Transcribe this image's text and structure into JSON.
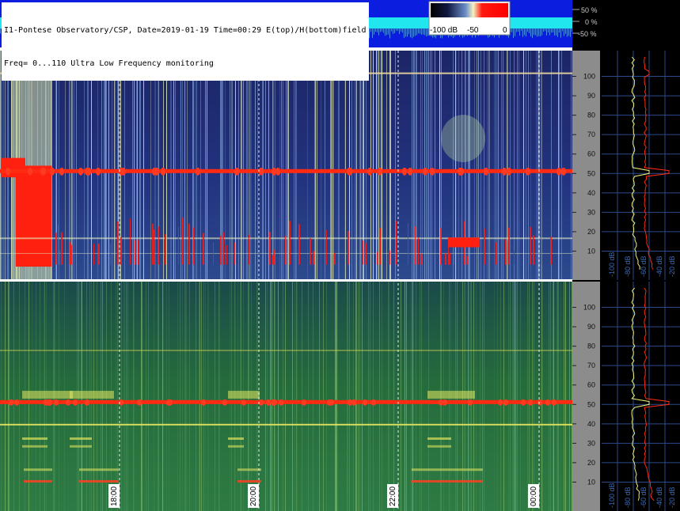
{
  "header": {
    "line1": "I1-Pontese Observatory/CSP, Date=2019-01-19 Time=00:29 E(top)/H(bottom)field",
    "line2": "Freq= 0...110 Ultra Low Frequency monitoring"
  },
  "level_strip": {
    "tick_labels": [
      "50 %",
      "0 %",
      "-50 %"
    ]
  },
  "colorbar": {
    "labels": [
      "-100 dB",
      "-50",
      "0"
    ],
    "colors": [
      "#000000",
      "#1a2a8c",
      "#dfe8b0",
      "#ff0000"
    ]
  },
  "colors": {
    "background": "#000000",
    "e_field_bg": "#22307a",
    "h_field_bg": "#1f6a3c",
    "strip_blue": "#0b1ee0",
    "strip_cyan": "#22e6ee",
    "signal_red": "#ff2a12",
    "spectrum_yellow": "#eef07a",
    "axis_panel": "#8c8c8c",
    "grid_blue": "#2a4a8a"
  },
  "chart_data": {
    "type": "heatmap",
    "panels": [
      {
        "name": "E(top)",
        "ylim": [
          0,
          110
        ],
        "y_ticks": [
          10,
          20,
          30,
          40,
          50,
          60,
          70,
          80,
          90,
          100
        ],
        "time_markers": [
          "18:00",
          "20:00",
          "22:00",
          "00:00"
        ],
        "spectrum_ticks": [
          "-100 dB",
          "-80 dB",
          "-60 dB",
          "-40 dB",
          "-20 dB"
        ]
      },
      {
        "name": "H(bottom)",
        "ylim": [
          0,
          110
        ],
        "y_ticks": [
          10,
          20,
          30,
          40,
          50,
          60,
          70,
          80,
          90,
          100
        ],
        "time_markers": [
          "18:00",
          "20:00",
          "22:00",
          "00:00"
        ],
        "spectrum_ticks": [
          "-100 dB",
          "-80 dB",
          "-60 dB",
          "-40 dB",
          "-20 dB"
        ]
      }
    ],
    "dominant_line_hz": 50
  }
}
